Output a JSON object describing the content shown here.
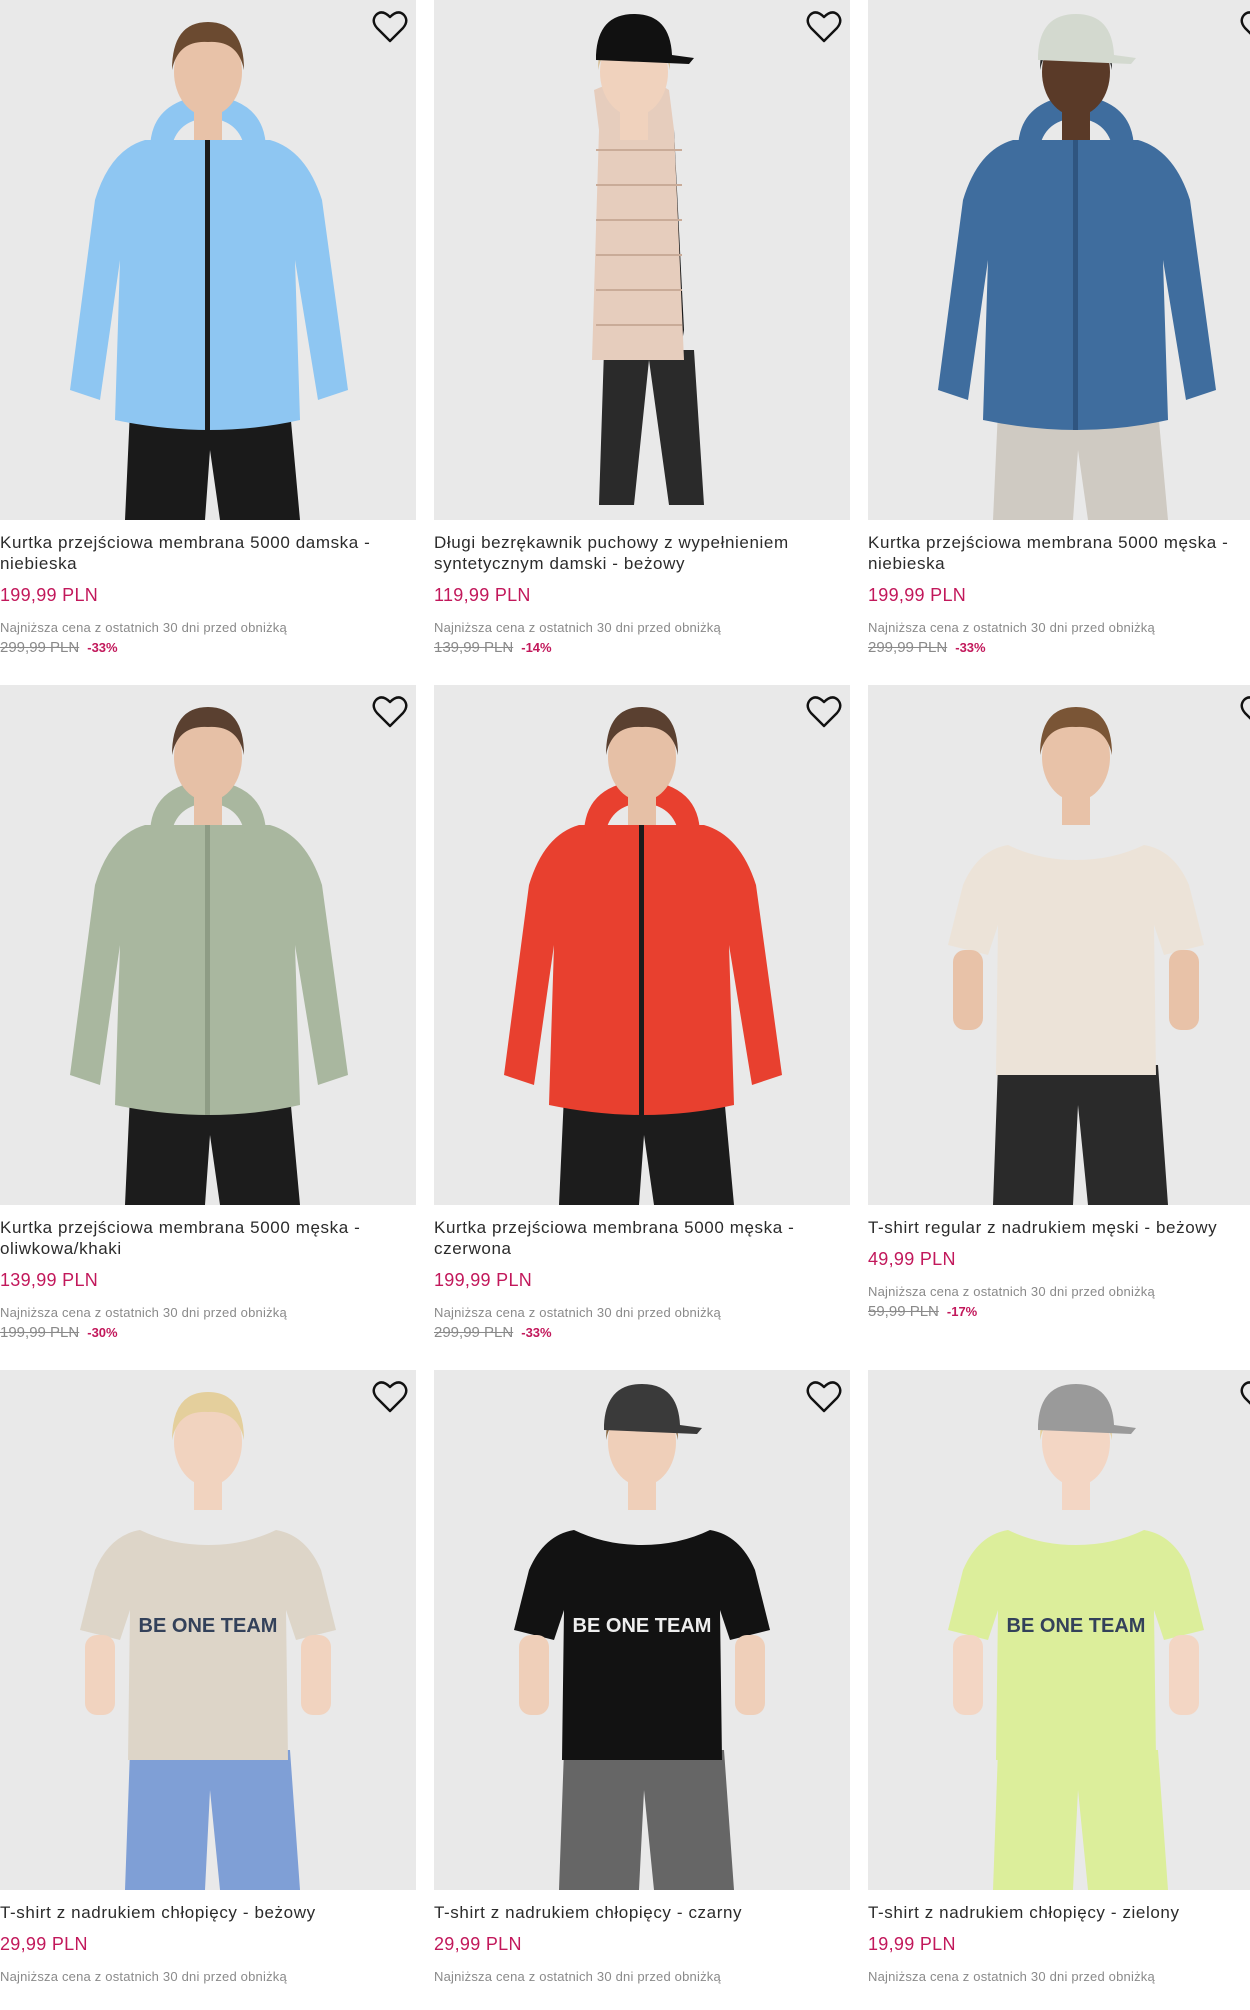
{
  "colors": {
    "price": "#c2185b",
    "muted": "#8a8a8a",
    "tile_bg": "#e9e9e9"
  },
  "icons": {
    "favorite": "heart-outline-icon"
  },
  "products": [
    {
      "name": "Kurtka przejściowa membrana 5000 damska - niebieska",
      "price": "199,99 PLN",
      "lowest_label": "Najniższa cena z ostatnich 30 dni przed obniżką",
      "old_price": "299,99 PLN",
      "discount": "-33%",
      "garment": "jacket",
      "color": "#8ec6f2",
      "zip": "#1b1b1b",
      "legs": "#1a1a1a",
      "skin": "#e8c2a8",
      "hair": "#6b4a30",
      "cap": ""
    },
    {
      "name": "Długi bezrękawnik puchowy z wypełnieniem syntetycznym damski - beżowy",
      "price": "119,99 PLN",
      "lowest_label": "Najniższa cena z ostatnich 30 dni przed obniżką",
      "old_price": "139,99 PLN",
      "discount": "-14%",
      "garment": "vest",
      "color": "#e6cdbd",
      "zip": "#c9ab98",
      "legs": "#2a2a2a",
      "skin": "#f0d2bd",
      "hair": "#d8c19a",
      "cap": "#111111"
    },
    {
      "name": "Kurtka przejściowa membrana 5000 męska - niebieska",
      "price": "199,99 PLN",
      "lowest_label": "Najniższa cena z ostatnich 30 dni przed obniżką",
      "old_price": "299,99 PLN",
      "discount": "-33%",
      "garment": "jacket",
      "color": "#3f6d9e",
      "zip": "#2f5580",
      "legs": "#cfcac2",
      "skin": "#5a3a28",
      "hair": "#222222",
      "cap": "#d3d9cf"
    },
    {
      "name": "Kurtka przejściowa membrana 5000 męska - oliwkowa/khaki",
      "price": "139,99 PLN",
      "lowest_label": "Najniższa cena z ostatnich 30 dni przed obniżką",
      "old_price": "199,99 PLN",
      "discount": "-30%",
      "garment": "jacket",
      "color": "#a9b79f",
      "zip": "#8e9c85",
      "legs": "#1c1c1c",
      "skin": "#e6c0a6",
      "hair": "#5a4030",
      "cap": ""
    },
    {
      "name": "Kurtka przejściowa membrana 5000 męska - czerwona",
      "price": "199,99 PLN",
      "lowest_label": "Najniższa cena z ostatnich 30 dni przed obniżką",
      "old_price": "299,99 PLN",
      "discount": "-33%",
      "garment": "jacket",
      "color": "#e8402f",
      "zip": "#1b1b1b",
      "legs": "#1c1c1c",
      "skin": "#e6c0a6",
      "hair": "#5a4030",
      "cap": ""
    },
    {
      "name": "T-shirt regular z nadrukiem męski - beżowy",
      "price": "49,99 PLN",
      "lowest_label": "Najniższa cena z ostatnich 30 dni przed obniżką",
      "old_price": "59,99 PLN",
      "discount": "-17%",
      "garment": "tshirt",
      "color": "#ece3d8",
      "zip": "",
      "legs": "#2a2a2a",
      "skin": "#e8c2a8",
      "hair": "#7a5536",
      "cap": ""
    },
    {
      "name": "T-shirt z nadrukiem chłopięcy - beżowy",
      "price": "29,99 PLN",
      "lowest_label": "Najniższa cena z ostatnich 30 dni przed obniżką",
      "print": "BE ONE TEAM",
      "garment": "tshirt",
      "color": "#ddd5c8",
      "zip": "",
      "legs": "#7f9fd6",
      "skin": "#f1d3bf",
      "hair": "#e4cf9c",
      "cap": ""
    },
    {
      "name": "T-shirt z nadrukiem chłopięcy - czarny",
      "price": "29,99 PLN",
      "lowest_label": "Najniższa cena z ostatnich 30 dni przed obniżką",
      "print": "BE ONE TEAM",
      "garment": "tshirt",
      "color": "#121212",
      "zip": "",
      "legs": "#666666",
      "skin": "#efcfb9",
      "hair": "#8a6a45",
      "cap": "#3a3a3a"
    },
    {
      "name": "T-shirt z nadrukiem chłopięcy - zielony",
      "price": "19,99 PLN",
      "lowest_label": "Najniższa cena z ostatnich 30 dni przed obniżką",
      "print": "BE ONE TEAM",
      "garment": "tshirt",
      "color": "#dcee9b",
      "zip": "",
      "legs": "#dcee9b",
      "skin": "#f3d6c4",
      "hair": "#e6cf9a",
      "cap": "#9a9a9a"
    }
  ]
}
